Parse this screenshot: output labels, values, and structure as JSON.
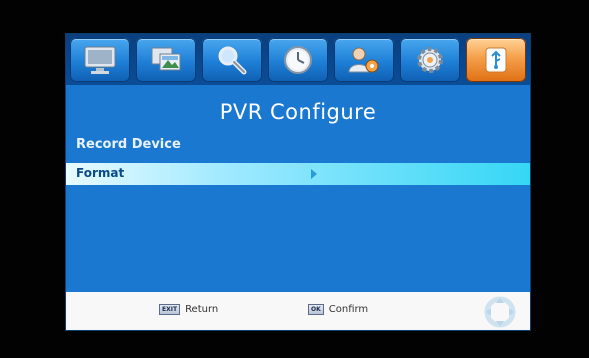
{
  "menu": {
    "tabs": [
      {
        "name": "tv-monitor-icon",
        "active": false
      },
      {
        "name": "picture-icon",
        "active": false
      },
      {
        "name": "search-icon",
        "active": false
      },
      {
        "name": "clock-icon",
        "active": false
      },
      {
        "name": "user-settings-icon",
        "active": false
      },
      {
        "name": "gear-icon",
        "active": false
      },
      {
        "name": "usb-icon",
        "active": true
      }
    ]
  },
  "page": {
    "title": "PVR Configure",
    "section": "Record Device",
    "items": [
      {
        "label": "Format",
        "selected": true
      }
    ]
  },
  "footer": {
    "hints": [
      {
        "key": "EXIT",
        "label": "Return"
      },
      {
        "key": "OK",
        "label": "Confirm"
      }
    ]
  },
  "colors": {
    "background": "#1a78d0",
    "active_tab": "#f5a04a",
    "highlight": "#35d7f5"
  }
}
